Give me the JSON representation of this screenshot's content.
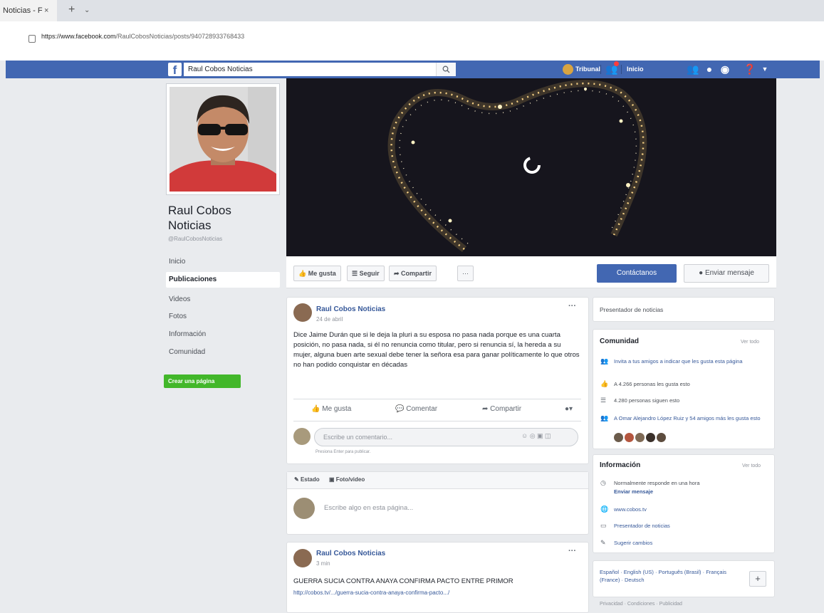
{
  "browser": {
    "tab_title": "Noticias - F",
    "tab_close": "×",
    "new_tab": "+",
    "tab_dropdown": "⌄",
    "url_domain": "https://www.facebook.com",
    "url_path": "/RaulCobosNoticias/posts/940728933768433"
  },
  "fbnav": {
    "search_value": "Raul Cobos Noticias",
    "user_name": "Tribunal",
    "home_label": "Inicio"
  },
  "page": {
    "name": "Raul Cobos Noticias",
    "handle": "@RaulCobosNoticias",
    "nav": [
      "Inicio",
      "Publicaciones",
      "Videos",
      "Fotos",
      "Información",
      "Comunidad"
    ],
    "create_page": "Crear una página"
  },
  "action_bar": {
    "like": "Me gusta",
    "follow": "Seguir",
    "share": "Compartir",
    "more": "···",
    "contact": "Contáctanos",
    "message": "Enviar mensaje"
  },
  "post1": {
    "author": "Raul Cobos Noticias",
    "time": "24 de abril",
    "more": "···",
    "text": "Dice Jaime Durán que si le deja la pluri a su esposa no pasa nada porque es una cuarta posición, no pasa nada, si él no renuncia como titular, pero si renuncia sí, la hereda a su mujer, alguna buen arte sexual debe tener la señora esa para ganar políticamente lo que otros no han podido conquistar en décadas",
    "like": "Me gusta",
    "comment": "Comentar",
    "share": "Compartir",
    "comment_placeholder": "Escribe un comentario...",
    "hint": "Presiona Enter para publicar."
  },
  "composer": {
    "status": "Estado",
    "photo": "Foto/video",
    "placeholder": "Escribe algo en esta página..."
  },
  "post2": {
    "author": "Raul Cobos Noticias",
    "time": "3 min",
    "more": "···",
    "text": "GUERRA SUCIA CONTRA ANAYA CONFIRMA PACTO ENTRE PRIMOR",
    "link": "http://cobos.tv/.../guerra-sucia-contra-anaya-confirma-pacto.../"
  },
  "sidebar": {
    "category": "Presentador de noticias",
    "community": {
      "title": "Comunidad",
      "see_all": "Ver todo",
      "invite": "Invita a tus amigos a indicar que les gusta esta página",
      "likes": "A 4.266 personas les gusta esto",
      "follows": "4.280 personas siguen esto",
      "friends": "A Omar Alejandro López Ruiz y 54 amigos más les gusta esto"
    },
    "info": {
      "title": "Información",
      "see_all": "Ver todo",
      "response": "Normalmente responde en una hora",
      "send_message": "Enviar mensaje",
      "website": "www.cobos.tv",
      "category": "Presentador de noticias",
      "suggest": "Sugerir cambios"
    },
    "languages": {
      "text": "Español · English (US) · Português (Brasil) · Français (France) · Deutsch",
      "add": "+"
    },
    "footer": "Privacidad · Condiciones · Publicidad"
  }
}
